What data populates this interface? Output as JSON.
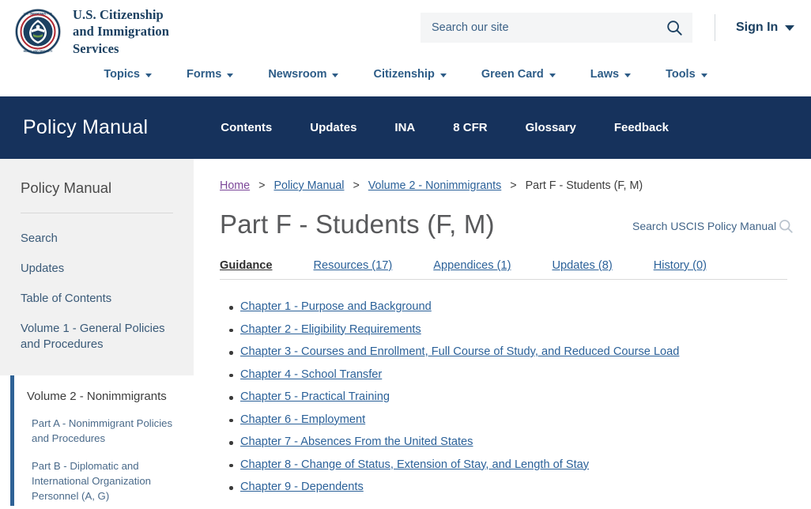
{
  "header": {
    "agency_name": "U.S. Citizenship\nand Immigration\nServices",
    "seal_alt": "dhs-seal",
    "search": {
      "placeholder": "Search our site",
      "value": "",
      "icon": "search-icon"
    },
    "signin_label": "Sign In",
    "signin_caret": "chevron-down-icon"
  },
  "primary_nav": {
    "items": [
      {
        "label": "Topics",
        "caret": "chevron-down-icon"
      },
      {
        "label": "Forms",
        "caret": "chevron-down-icon"
      },
      {
        "label": "Newsroom",
        "caret": "chevron-down-icon"
      },
      {
        "label": "Citizenship",
        "caret": "chevron-down-icon"
      },
      {
        "label": "Green Card",
        "caret": "chevron-down-icon"
      },
      {
        "label": "Laws",
        "caret": "chevron-down-icon"
      },
      {
        "label": "Tools",
        "caret": "chevron-down-icon"
      }
    ]
  },
  "policy_manual_bar": {
    "title": "Policy Manual",
    "links": [
      {
        "label": "Contents"
      },
      {
        "label": "Updates"
      },
      {
        "label": "INA"
      },
      {
        "label": "8 CFR"
      },
      {
        "label": "Glossary"
      },
      {
        "label": "Feedback"
      }
    ],
    "search": {
      "placeholder": "Search USCIS Policy Manual",
      "value": "",
      "icon": "search-icon"
    },
    "background_color": "#16325C"
  },
  "sidebar": {
    "heading": "Policy Manual",
    "links": [
      {
        "label": "Search"
      },
      {
        "label": "Updates"
      },
      {
        "label": "Table of Contents"
      },
      {
        "label": "Volume 1 - General Policies and Procedures"
      }
    ],
    "active_group": {
      "volume_label": "Volume 2 - Nonimmigrants",
      "accent_color": "#2F6296",
      "parts": [
        {
          "label": "Part A - Nonimmigrant Policies and Procedures"
        },
        {
          "label": "Part B - Diplomatic and International Organization Personnel (A, G)"
        }
      ]
    }
  },
  "main": {
    "breadcrumb": [
      {
        "label": "Home",
        "type": "link-visited"
      },
      {
        "label": "Policy Manual",
        "type": "link"
      },
      {
        "label": "Volume 2 - Nonimmigrants",
        "type": "link"
      },
      {
        "label": "Part F - Students (F, M)",
        "type": "current"
      }
    ],
    "breadcrumb_separator": ">",
    "page_title": "Part F - Students (F, M)",
    "tabs": [
      {
        "label": "Guidance",
        "active": true
      },
      {
        "label": "Resources (17)",
        "active": false
      },
      {
        "label": "Appendices (1)",
        "active": false
      },
      {
        "label": "Updates (8)",
        "active": false
      },
      {
        "label": "History (0)",
        "active": false
      }
    ],
    "chapters": [
      {
        "label": "Chapter 1 - Purpose and Background"
      },
      {
        "label": "Chapter 2 - Eligibility Requirements"
      },
      {
        "label": "Chapter 3 - Courses and Enrollment, Full Course of Study, and Reduced Course Load"
      },
      {
        "label": "Chapter 4 - School Transfer"
      },
      {
        "label": "Chapter 5 - Practical Training"
      },
      {
        "label": "Chapter 6 - Employment"
      },
      {
        "label": "Chapter 7 - Absences From the United States"
      },
      {
        "label": "Chapter 8 - Change of Status, Extension of Stay, and Length of Stay"
      },
      {
        "label": "Chapter 9 - Dependents"
      }
    ]
  },
  "colors": {
    "navy": "#16325C",
    "link_blue": "#2B6199",
    "visited_purple": "#7C4799",
    "sidebar_gray": "#F1F1F1",
    "title_gray": "#58595B"
  }
}
